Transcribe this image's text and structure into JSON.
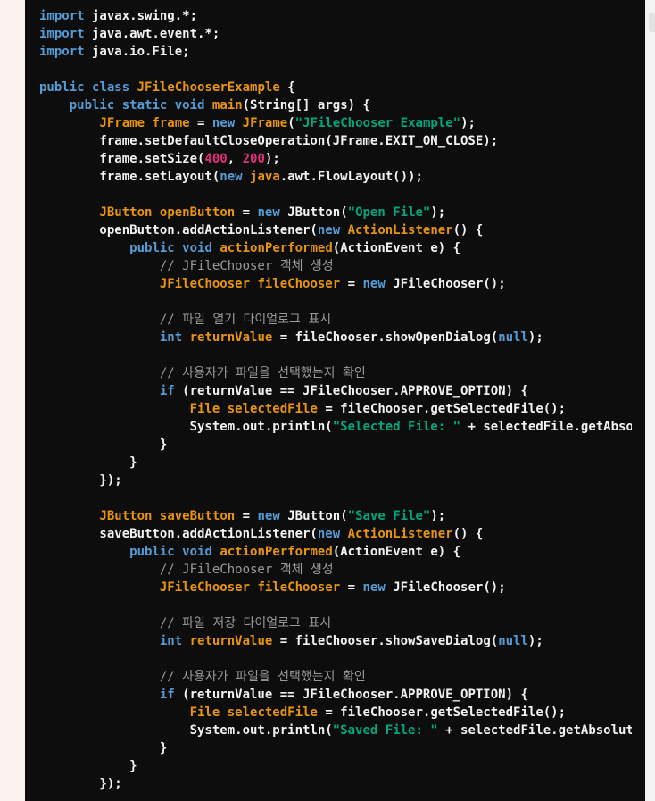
{
  "code": {
    "language": "java",
    "lines": [
      [
        {
          "t": "import",
          "c": "kw"
        },
        {
          "t": " javax.swing.*;",
          "c": "pl"
        }
      ],
      [
        {
          "t": "import",
          "c": "kw"
        },
        {
          "t": " java.awt.event.*;",
          "c": "pl"
        }
      ],
      [
        {
          "t": "import",
          "c": "kw"
        },
        {
          "t": " java.io.File;",
          "c": "pl"
        }
      ],
      [],
      [
        {
          "t": "public",
          "c": "kw"
        },
        {
          "t": " ",
          "c": "pl"
        },
        {
          "t": "class",
          "c": "kw"
        },
        {
          "t": " ",
          "c": "pl"
        },
        {
          "t": "JFileChooserExample",
          "c": "ty"
        },
        {
          "t": " {",
          "c": "pl"
        }
      ],
      [
        {
          "t": "    ",
          "c": "pl"
        },
        {
          "t": "public",
          "c": "kw"
        },
        {
          "t": " ",
          "c": "pl"
        },
        {
          "t": "static",
          "c": "kw"
        },
        {
          "t": " ",
          "c": "pl"
        },
        {
          "t": "void",
          "c": "kw"
        },
        {
          "t": " ",
          "c": "pl"
        },
        {
          "t": "main",
          "c": "ty"
        },
        {
          "t": "(String[] args) {",
          "c": "pl"
        }
      ],
      [
        {
          "t": "        ",
          "c": "pl"
        },
        {
          "t": "JFrame",
          "c": "ty"
        },
        {
          "t": " ",
          "c": "pl"
        },
        {
          "t": "frame",
          "c": "ty"
        },
        {
          "t": " = ",
          "c": "pl"
        },
        {
          "t": "new",
          "c": "kw"
        },
        {
          "t": " ",
          "c": "pl"
        },
        {
          "t": "JFrame",
          "c": "ty"
        },
        {
          "t": "(",
          "c": "pl"
        },
        {
          "t": "\"JFileChooser Example\"",
          "c": "str"
        },
        {
          "t": ");",
          "c": "pl"
        }
      ],
      [
        {
          "t": "        frame.setDefaultCloseOperation(JFrame.EXIT_ON_CLOSE);",
          "c": "pl"
        }
      ],
      [
        {
          "t": "        frame.setSize(",
          "c": "pl"
        },
        {
          "t": "400",
          "c": "num"
        },
        {
          "t": ", ",
          "c": "pl"
        },
        {
          "t": "200",
          "c": "num"
        },
        {
          "t": ");",
          "c": "pl"
        }
      ],
      [
        {
          "t": "        frame.setLayout(",
          "c": "pl"
        },
        {
          "t": "new",
          "c": "kw"
        },
        {
          "t": " ",
          "c": "pl"
        },
        {
          "t": "java",
          "c": "ty"
        },
        {
          "t": ".awt.FlowLayout());",
          "c": "pl"
        }
      ],
      [],
      [
        {
          "t": "        ",
          "c": "pl"
        },
        {
          "t": "JButton",
          "c": "ty"
        },
        {
          "t": " ",
          "c": "pl"
        },
        {
          "t": "openButton",
          "c": "ty"
        },
        {
          "t": " = ",
          "c": "pl"
        },
        {
          "t": "new",
          "c": "kw"
        },
        {
          "t": " JButton(",
          "c": "pl"
        },
        {
          "t": "\"Open File\"",
          "c": "str"
        },
        {
          "t": ");",
          "c": "pl"
        }
      ],
      [
        {
          "t": "        openButton.addActionListener(",
          "c": "pl"
        },
        {
          "t": "new",
          "c": "kw"
        },
        {
          "t": " ",
          "c": "pl"
        },
        {
          "t": "ActionListener",
          "c": "ty"
        },
        {
          "t": "() {",
          "c": "pl"
        }
      ],
      [
        {
          "t": "            ",
          "c": "pl"
        },
        {
          "t": "public",
          "c": "kw"
        },
        {
          "t": " ",
          "c": "pl"
        },
        {
          "t": "void",
          "c": "kw"
        },
        {
          "t": " ",
          "c": "pl"
        },
        {
          "t": "actionPerformed",
          "c": "ty"
        },
        {
          "t": "(ActionEvent e) {",
          "c": "pl"
        }
      ],
      [
        {
          "t": "                ",
          "c": "pl"
        },
        {
          "t": "// JFileChooser 객체 생성",
          "c": "cm"
        }
      ],
      [
        {
          "t": "                ",
          "c": "pl"
        },
        {
          "t": "JFileChooser",
          "c": "ty"
        },
        {
          "t": " ",
          "c": "pl"
        },
        {
          "t": "fileChooser",
          "c": "ty"
        },
        {
          "t": " = ",
          "c": "pl"
        },
        {
          "t": "new",
          "c": "kw"
        },
        {
          "t": " JFileChooser();",
          "c": "pl"
        }
      ],
      [],
      [
        {
          "t": "                ",
          "c": "pl"
        },
        {
          "t": "// 파일 열기 다이얼로그 표시",
          "c": "cm"
        }
      ],
      [
        {
          "t": "                ",
          "c": "pl"
        },
        {
          "t": "int",
          "c": "kw"
        },
        {
          "t": " ",
          "c": "pl"
        },
        {
          "t": "returnValue",
          "c": "ty"
        },
        {
          "t": " = fileChooser.showOpenDialog(",
          "c": "pl"
        },
        {
          "t": "null",
          "c": "kw"
        },
        {
          "t": ");",
          "c": "pl"
        }
      ],
      [],
      [
        {
          "t": "                ",
          "c": "pl"
        },
        {
          "t": "// 사용자가 파일을 선택했는지 확인",
          "c": "cm"
        }
      ],
      [
        {
          "t": "                ",
          "c": "pl"
        },
        {
          "t": "if",
          "c": "kw"
        },
        {
          "t": " (returnValue == JFileChooser.APPROVE_OPTION) {",
          "c": "pl"
        }
      ],
      [
        {
          "t": "                    ",
          "c": "pl"
        },
        {
          "t": "File",
          "c": "ty"
        },
        {
          "t": " ",
          "c": "pl"
        },
        {
          "t": "selectedFile",
          "c": "ty"
        },
        {
          "t": " = fileChooser.getSelectedFile();",
          "c": "pl"
        }
      ],
      [
        {
          "t": "                    System.out.println(",
          "c": "pl"
        },
        {
          "t": "\"Selected File: \"",
          "c": "str"
        },
        {
          "t": " + selectedFile.getAbsolutePath());",
          "c": "pl"
        }
      ],
      [
        {
          "t": "                }",
          "c": "pl"
        }
      ],
      [
        {
          "t": "            }",
          "c": "pl"
        }
      ],
      [
        {
          "t": "        });",
          "c": "pl"
        }
      ],
      [],
      [
        {
          "t": "        ",
          "c": "pl"
        },
        {
          "t": "JButton",
          "c": "ty"
        },
        {
          "t": " ",
          "c": "pl"
        },
        {
          "t": "saveButton",
          "c": "ty"
        },
        {
          "t": " = ",
          "c": "pl"
        },
        {
          "t": "new",
          "c": "kw"
        },
        {
          "t": " JButton(",
          "c": "pl"
        },
        {
          "t": "\"Save File\"",
          "c": "str"
        },
        {
          "t": ");",
          "c": "pl"
        }
      ],
      [
        {
          "t": "        saveButton.addActionListener(",
          "c": "pl"
        },
        {
          "t": "new",
          "c": "kw"
        },
        {
          "t": " ",
          "c": "pl"
        },
        {
          "t": "ActionListener",
          "c": "ty"
        },
        {
          "t": "() {",
          "c": "pl"
        }
      ],
      [
        {
          "t": "            ",
          "c": "pl"
        },
        {
          "t": "public",
          "c": "kw"
        },
        {
          "t": " ",
          "c": "pl"
        },
        {
          "t": "void",
          "c": "kw"
        },
        {
          "t": " ",
          "c": "pl"
        },
        {
          "t": "actionPerformed",
          "c": "ty"
        },
        {
          "t": "(ActionEvent e) {",
          "c": "pl"
        }
      ],
      [
        {
          "t": "                ",
          "c": "pl"
        },
        {
          "t": "// JFileChooser 객체 생성",
          "c": "cm"
        }
      ],
      [
        {
          "t": "                ",
          "c": "pl"
        },
        {
          "t": "JFileChooser",
          "c": "ty"
        },
        {
          "t": " ",
          "c": "pl"
        },
        {
          "t": "fileChooser",
          "c": "ty"
        },
        {
          "t": " = ",
          "c": "pl"
        },
        {
          "t": "new",
          "c": "kw"
        },
        {
          "t": " JFileChooser();",
          "c": "pl"
        }
      ],
      [],
      [
        {
          "t": "                ",
          "c": "pl"
        },
        {
          "t": "// 파일 저장 다이얼로그 표시",
          "c": "cm"
        }
      ],
      [
        {
          "t": "                ",
          "c": "pl"
        },
        {
          "t": "int",
          "c": "kw"
        },
        {
          "t": " ",
          "c": "pl"
        },
        {
          "t": "returnValue",
          "c": "ty"
        },
        {
          "t": " = fileChooser.showSaveDialog(",
          "c": "pl"
        },
        {
          "t": "null",
          "c": "kw"
        },
        {
          "t": ");",
          "c": "pl"
        }
      ],
      [],
      [
        {
          "t": "                ",
          "c": "pl"
        },
        {
          "t": "// 사용자가 파일을 선택했는지 확인",
          "c": "cm"
        }
      ],
      [
        {
          "t": "                ",
          "c": "pl"
        },
        {
          "t": "if",
          "c": "kw"
        },
        {
          "t": " (returnValue == JFileChooser.APPROVE_OPTION) {",
          "c": "pl"
        }
      ],
      [
        {
          "t": "                    ",
          "c": "pl"
        },
        {
          "t": "File",
          "c": "ty"
        },
        {
          "t": " ",
          "c": "pl"
        },
        {
          "t": "selectedFile",
          "c": "ty"
        },
        {
          "t": " = fileChooser.getSelectedFile();",
          "c": "pl"
        }
      ],
      [
        {
          "t": "                    System.out.println(",
          "c": "pl"
        },
        {
          "t": "\"Saved File: \"",
          "c": "str"
        },
        {
          "t": " + selectedFile.getAbsolutePath());",
          "c": "pl"
        }
      ],
      [
        {
          "t": "                }",
          "c": "pl"
        }
      ],
      [
        {
          "t": "            }",
          "c": "pl"
        }
      ],
      [
        {
          "t": "        });",
          "c": "pl"
        }
      ]
    ]
  },
  "colors": {
    "code_background": "#0d0d0d",
    "page_background": "#faf3ef",
    "keyword": "#569cd6",
    "type_or_identifier": "#e9950c",
    "string": "#00a67d",
    "number": "#df3079",
    "comment": "#9a9a9a",
    "plain": "#f2f2f2"
  }
}
